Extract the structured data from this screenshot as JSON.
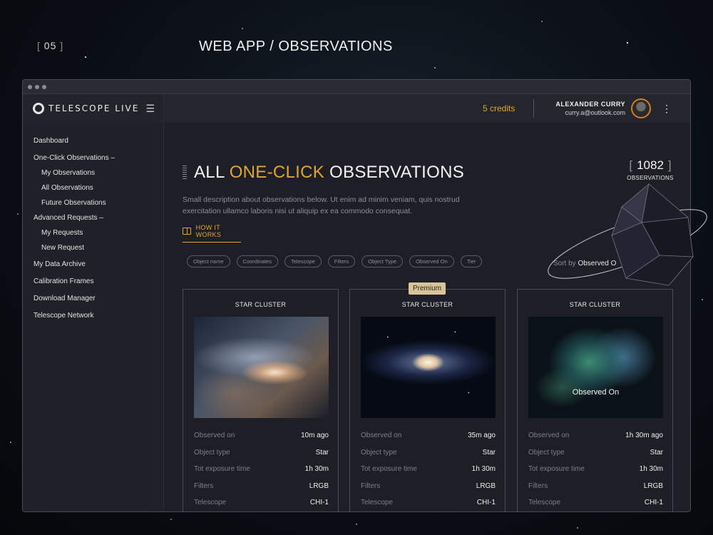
{
  "slide": {
    "number": "05",
    "title": "WEB APP / OBSERVATIONS"
  },
  "brand": {
    "name": "TELESCOPE LIVE"
  },
  "nav": {
    "items": [
      {
        "label": "Dashboard"
      },
      {
        "label": "One-Click Observations –"
      },
      {
        "label": "My Observations"
      },
      {
        "label": "All Observations"
      },
      {
        "label": "Future Observations"
      },
      {
        "label": "Advanced Requests –"
      },
      {
        "label": "My Requests"
      },
      {
        "label": "New Request"
      },
      {
        "label": "My Data Archive"
      },
      {
        "label": "Calibration Frames"
      },
      {
        "label": "Download Manager"
      },
      {
        "label": "Telescope Network"
      }
    ]
  },
  "topbar": {
    "credits": "5 credits",
    "user_name": "ALEXANDER CURRY",
    "user_email": "curry.a@outlook.com"
  },
  "page": {
    "heading_pre": "ALL ",
    "heading_highlight": "ONE-CLICK",
    "heading_post": " OBSERVATIONS",
    "description": "Small description about observations below. Ut enim ad minim veniam, quis nostrud exercitation ullamco laboris nisi ut aliquip ex ea commodo consequat.",
    "how_it_works": "HOW IT WORKS",
    "count": "1082",
    "count_label": "OBSERVATIONS",
    "sort_prefix": "Sort by ",
    "sort_value": "Observed O"
  },
  "filters": [
    "Object name",
    "Coordinates",
    "Telescope",
    "Filters",
    "Object Type",
    "Observed On",
    "Tier"
  ],
  "cards": [
    {
      "title": "STAR CLUSTER",
      "badge": "",
      "overlay": "",
      "rows": [
        {
          "key": "Observed on",
          "value": "10m ago"
        },
        {
          "key": "Object type",
          "value": "Star"
        },
        {
          "key": "Tot exposure time",
          "value": "1h 30m"
        },
        {
          "key": "Filters",
          "value": "LRGB"
        },
        {
          "key": "Telescope",
          "value": "CHI-1"
        }
      ]
    },
    {
      "title": "STAR CLUSTER",
      "badge": "Premium",
      "overlay": "",
      "rows": [
        {
          "key": "Observed on",
          "value": "35m ago"
        },
        {
          "key": "Object type",
          "value": "Star"
        },
        {
          "key": "Tot exposure time",
          "value": "1h 30m"
        },
        {
          "key": "Filters",
          "value": "LRGB"
        },
        {
          "key": "Telescope",
          "value": "CHI-1"
        }
      ]
    },
    {
      "title": "STAR CLUSTER",
      "badge": "",
      "overlay": "Observed On",
      "rows": [
        {
          "key": "Observed on",
          "value": "1h 30m ago"
        },
        {
          "key": "Object type",
          "value": "Star"
        },
        {
          "key": "Tot exposure time",
          "value": "1h 30m"
        },
        {
          "key": "Filters",
          "value": "LRGB"
        },
        {
          "key": "Telescope",
          "value": "CHI-1"
        }
      ]
    }
  ],
  "colors": {
    "accent": "#e0a533",
    "background": "#1e1f26",
    "badge": "#d9c49a"
  }
}
